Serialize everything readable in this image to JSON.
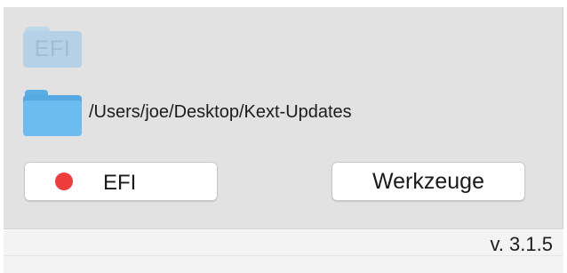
{
  "efi_drive": {
    "icon": "efi-drive-icon",
    "label": "EFI",
    "color": "#b4d1e8"
  },
  "kext_folder": {
    "icon": "folder-icon",
    "path": "/Users/joe/Desktop/Kext-Updates",
    "color": "#6cbcf0"
  },
  "buttons": {
    "efi": {
      "label": "EFI",
      "status_icon": "red-status-dot-icon",
      "status_color": "#ef3d3d"
    },
    "tools": {
      "label": "Werkzeuge"
    }
  },
  "footer": {
    "version": "v. 3.1.5"
  }
}
